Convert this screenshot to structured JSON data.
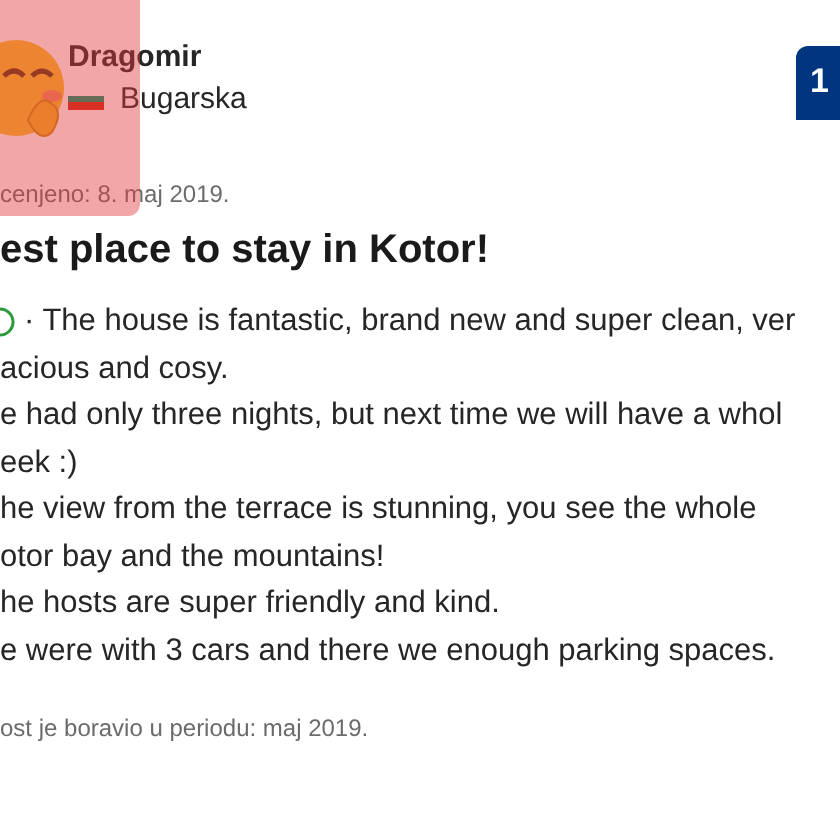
{
  "reviewer": {
    "name": "Dragomir",
    "country": "Bugarska"
  },
  "score": "1",
  "date": "cenjeno: 8. maj 2019.",
  "title": "est place to stay in Kotor!",
  "lines": [
    {
      "text": "· The house is fantastic, brand new and super clean, ver",
      "kind": "positive"
    },
    {
      "text": "acious and cosy.",
      "kind": "plain"
    },
    {
      "text": "e had only three nights, but next time we will have a whol",
      "kind": "plain"
    },
    {
      "text": "eek :)",
      "kind": "plain"
    },
    {
      "text": "he view from the terrace is stunning, you see the whole",
      "kind": "plain"
    },
    {
      "text": "otor bay and the mountains!",
      "kind": "plain"
    },
    {
      "text": "he hosts are super friendly and kind.",
      "kind": "plain"
    },
    {
      "text": "e were with 3 cars and there we enough parking spaces.",
      "kind": "plain"
    }
  ],
  "stay": "ost je boravio u periodu: maj 2019."
}
